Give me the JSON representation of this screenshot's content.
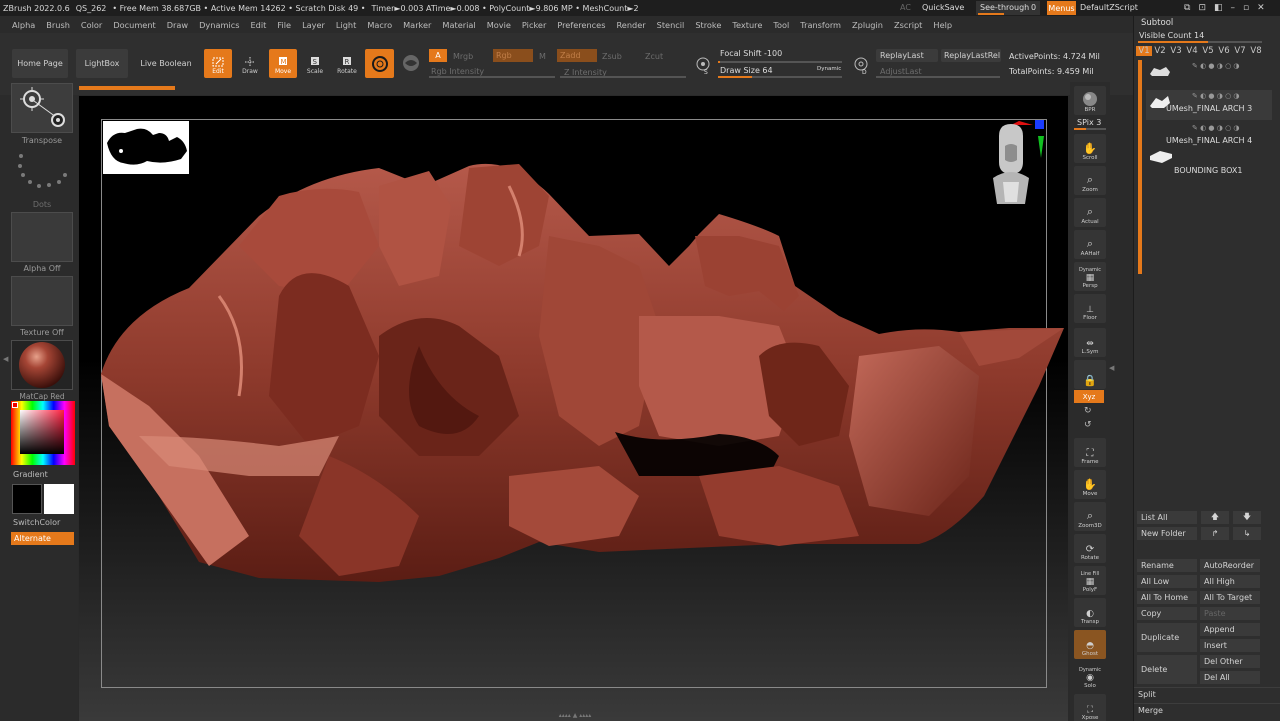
{
  "titlebar": {
    "app": "ZBrush 2022.0.6",
    "project": "QS_262",
    "stats": "• Free Mem 38.687GB • Active Mem 14262 • Scratch Disk 49 •",
    "timer": "Timer►0.003 ATime►0.008 • PolyCount►9.806 MP • MeshCount►2",
    "ac": "AC",
    "quicksave": "QuickSave",
    "see_through_label": "See-through",
    "see_through_value": "0",
    "menus": "Menus",
    "script": "DefaultZScript"
  },
  "menubar": [
    "Alpha",
    "Brush",
    "Color",
    "Document",
    "Draw",
    "Dynamics",
    "Edit",
    "File",
    "Layer",
    "Light",
    "Macro",
    "Marker",
    "Material",
    "Movie",
    "Picker",
    "Preferences",
    "Render",
    "Stencil",
    "Stroke",
    "Texture",
    "Tool",
    "Transform",
    "Zplugin",
    "Zscript",
    "Help"
  ],
  "shelf": {
    "home": "Home Page",
    "lightbox": "LightBox",
    "live_boolean": "Live Boolean",
    "edit": "Edit",
    "draw": "Draw",
    "move": "Move",
    "scale": "Scale",
    "rotate": "Rotate",
    "a": "A",
    "mrgb": "Mrgb",
    "rgb": "Rgb",
    "m": "M",
    "zadd": "Zadd",
    "zsub": "Zsub",
    "zcut": "Zcut",
    "rgb_intensity": "Rgb Intensity",
    "z_intensity": "Z Intensity",
    "focal_shift": "Focal Shift -100",
    "draw_size": "Draw Size 64",
    "dynamic": "Dynamic",
    "s": "S",
    "d": "D",
    "replay_last": "ReplayLast",
    "replay_last_rel": "ReplayLastRel",
    "adjust_last": "AdjustLast",
    "active_points": "ActivePoints: 4.724 Mil",
    "total_points": "TotalPoints: 9.459 Mil"
  },
  "left": {
    "transpose": "Transpose",
    "dots": "Dots",
    "alpha_off": "Alpha Off",
    "texture_off": "Texture Off",
    "material": "MatCap Red Wax",
    "gradient": "Gradient",
    "switch_color": "SwitchColor",
    "alternate": "Alternate"
  },
  "right": {
    "bpr": "BPR",
    "spix": "SPix 3",
    "scroll": "Scroll",
    "zoom": "Zoom",
    "actual": "Actual",
    "aahalf": "AAHalf",
    "dynamic_persp": "Dynamic",
    "persp": "Persp",
    "floor": "Floor",
    "lsym": "L.Sym",
    "lock": "",
    "xyz": "Xyz",
    "frame": "Frame",
    "move": "Move",
    "zoom3d": "Zoom3D",
    "rotate": "Rotate",
    "line_fill": "Line Fill",
    "polyf": "PolyF",
    "transp": "Transp",
    "ghost": "Ghost",
    "dynamic_solo": "Dynamic",
    "solo": "Solo",
    "xpose": "Xpose"
  },
  "subtool": {
    "title": "Subtool",
    "visible_count": "Visible Count 14",
    "tabs": [
      "V1",
      "V2",
      "V3",
      "V4",
      "V5",
      "V6",
      "V7",
      "V8"
    ],
    "items": [
      {
        "name": ""
      },
      {
        "name": "UMesh_FINAL ARCH 3"
      },
      {
        "name": "UMesh_FINAL ARCH 4"
      },
      {
        "name": "BOUNDING BOX1"
      }
    ],
    "list_all": "List All",
    "new_folder": "New Folder",
    "rename": "Rename",
    "autoreorder": "AutoReorder",
    "all_low": "All Low",
    "all_high": "All High",
    "all_to_home": "All To Home",
    "all_to_target": "All To Target",
    "copy": "Copy",
    "paste": "Paste",
    "duplicate": "Duplicate",
    "append": "Append",
    "insert": "Insert",
    "delete": "Delete",
    "del_other": "Del Other",
    "del_all": "Del All",
    "split": "Split",
    "merge": "Merge"
  },
  "colors": {
    "accent": "#e5791b",
    "clay": "#8e3a2c",
    "background": "#2a2a2a"
  }
}
